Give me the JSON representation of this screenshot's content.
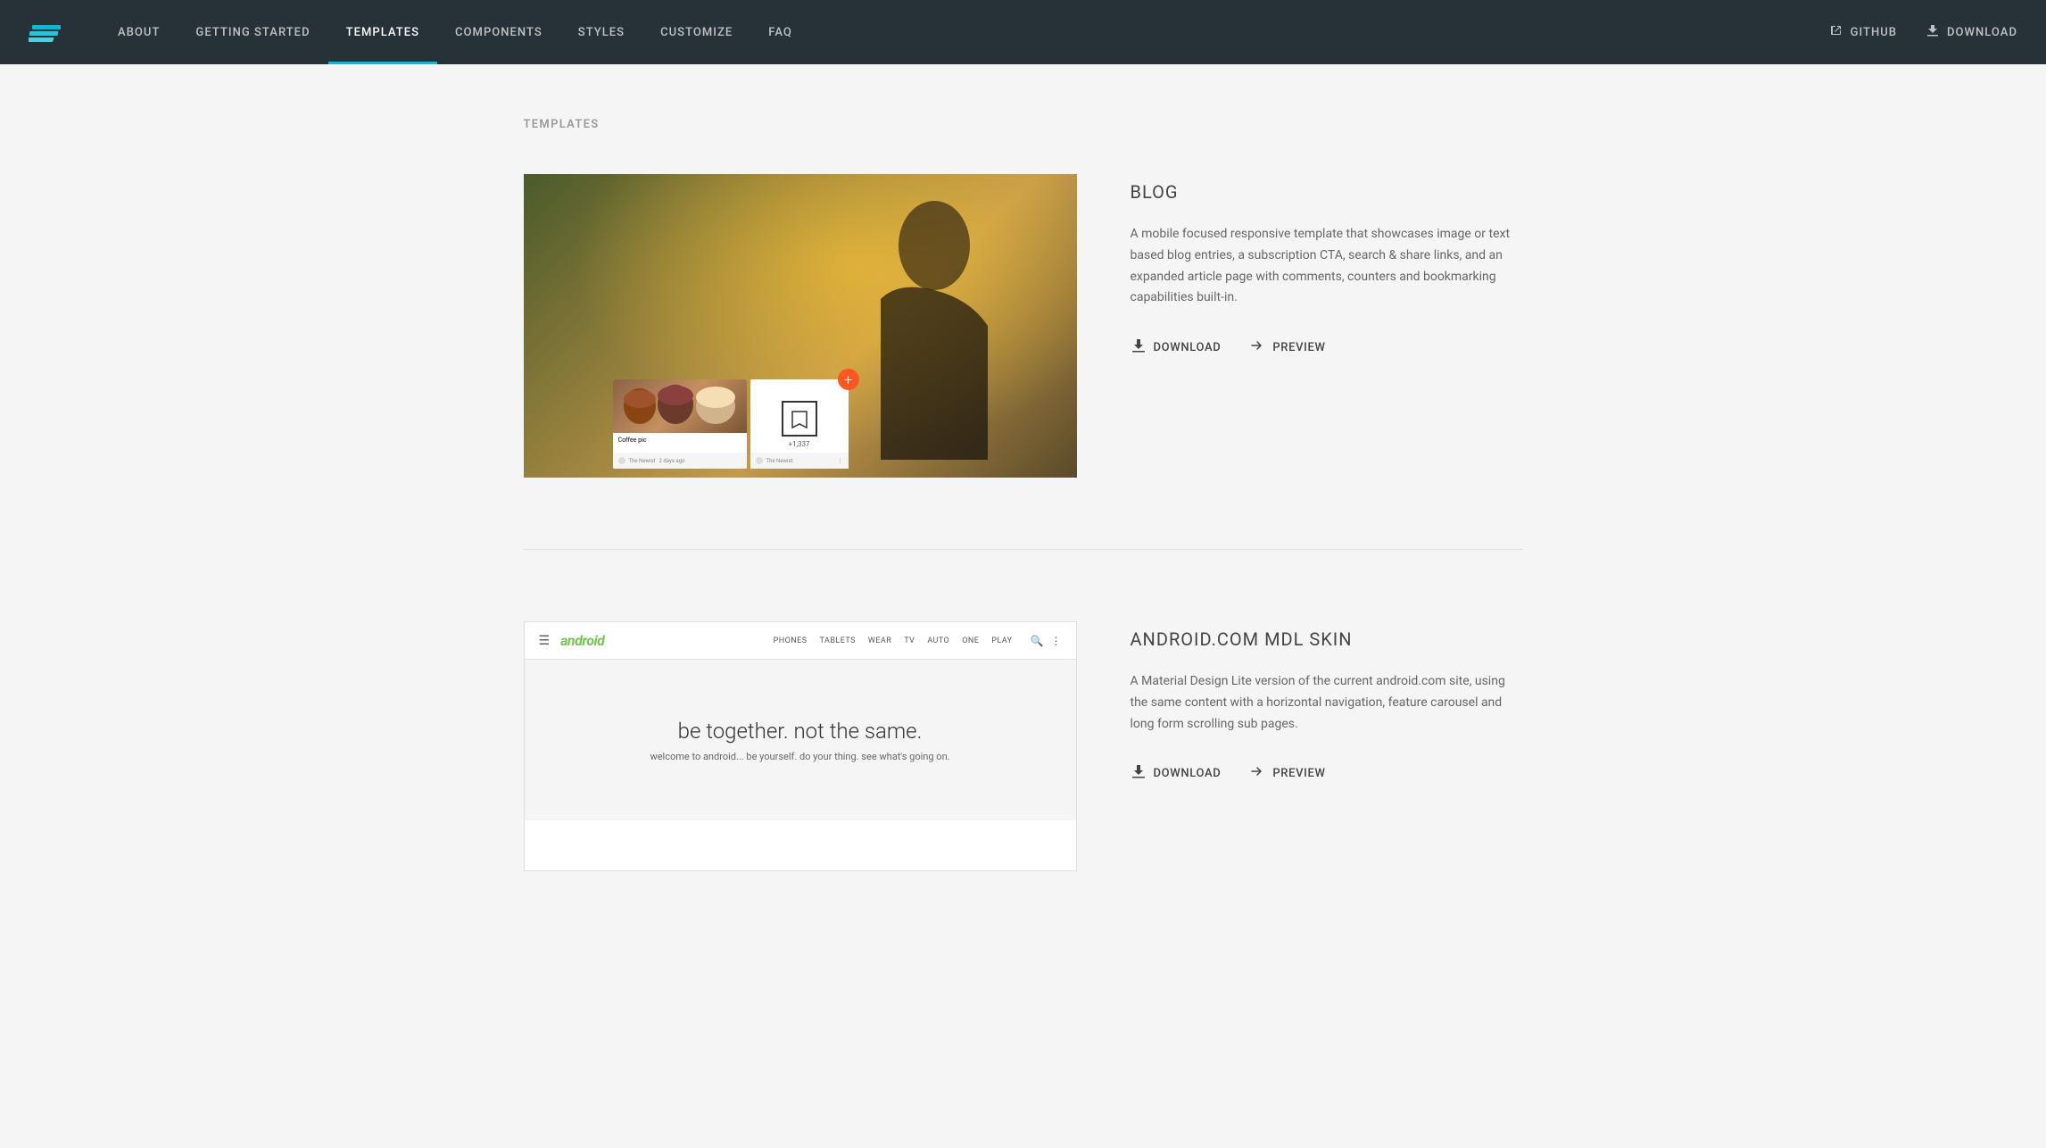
{
  "brand": {
    "logo_alt": "Material Design Lite"
  },
  "navbar": {
    "items": [
      {
        "id": "about",
        "label": "ABOUT",
        "active": false
      },
      {
        "id": "getting-started",
        "label": "GETTING STARTED",
        "active": false
      },
      {
        "id": "templates",
        "label": "TEMPLATES",
        "active": true
      },
      {
        "id": "components",
        "label": "COMPONENTS",
        "active": false
      },
      {
        "id": "styles",
        "label": "STYLES",
        "active": false
      },
      {
        "id": "customize",
        "label": "CUSTOMIZE",
        "active": false
      },
      {
        "id": "faq",
        "label": "FAQ",
        "active": false
      }
    ],
    "github_label": "GitHub",
    "download_label": "Download"
  },
  "page": {
    "title": "TEMPLATES"
  },
  "templates": [
    {
      "id": "blog",
      "name": "BLOG",
      "description": "A mobile focused responsive template that showcases image or text based blog entries, a subscription CTA, search & share links, and an expanded article page with comments, counters and bookmarking capabilities built-in.",
      "download_label": "Download",
      "preview_label": "Preview",
      "preview_image_label": "Coffee pic",
      "preview_count": "+1,337"
    },
    {
      "id": "android",
      "name": "ANDROID.COM MDL SKIN",
      "description": "A Material Design Lite version of the current android.com site, using the same content with a horizontal navigation, feature carousel and long form scrolling sub pages.",
      "download_label": "Download",
      "preview_label": "Preview",
      "hero_title": "be together. not the same.",
      "hero_subtitle": "welcome to android... be yourself. do your thing. see what's going on.",
      "nav_links": [
        "PHONES",
        "TABLETS",
        "WEAR",
        "TV",
        "AUTO",
        "ONE",
        "PLAY"
      ]
    }
  ]
}
